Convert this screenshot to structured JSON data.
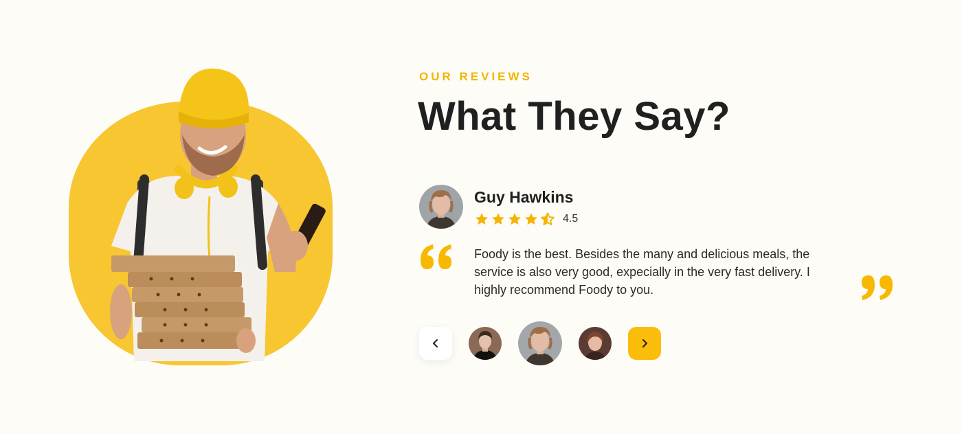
{
  "section": {
    "eyebrow": "OUR REVIEWS",
    "title": "What They Say?"
  },
  "reviewer": {
    "name": "Guy Hawkins",
    "rating_value": "4.5",
    "rating": 4.5,
    "avatar_icon": "reviewer-avatar"
  },
  "review": {
    "text": "Foody is the best. Besides the many and delicious meals, the service is also very good, expecially in the very fast delivery. I highly recommend Foody to you."
  },
  "carousel": {
    "prev_icon": "chevron-left-icon",
    "next_icon": "chevron-right-icon",
    "thumbnails": [
      "avatar-1",
      "avatar-2-active",
      "avatar-3"
    ]
  },
  "colors": {
    "accent": "#F4B400",
    "button_accent": "#FBBD0B",
    "background": "#FDFCF6",
    "title": "#202020"
  }
}
